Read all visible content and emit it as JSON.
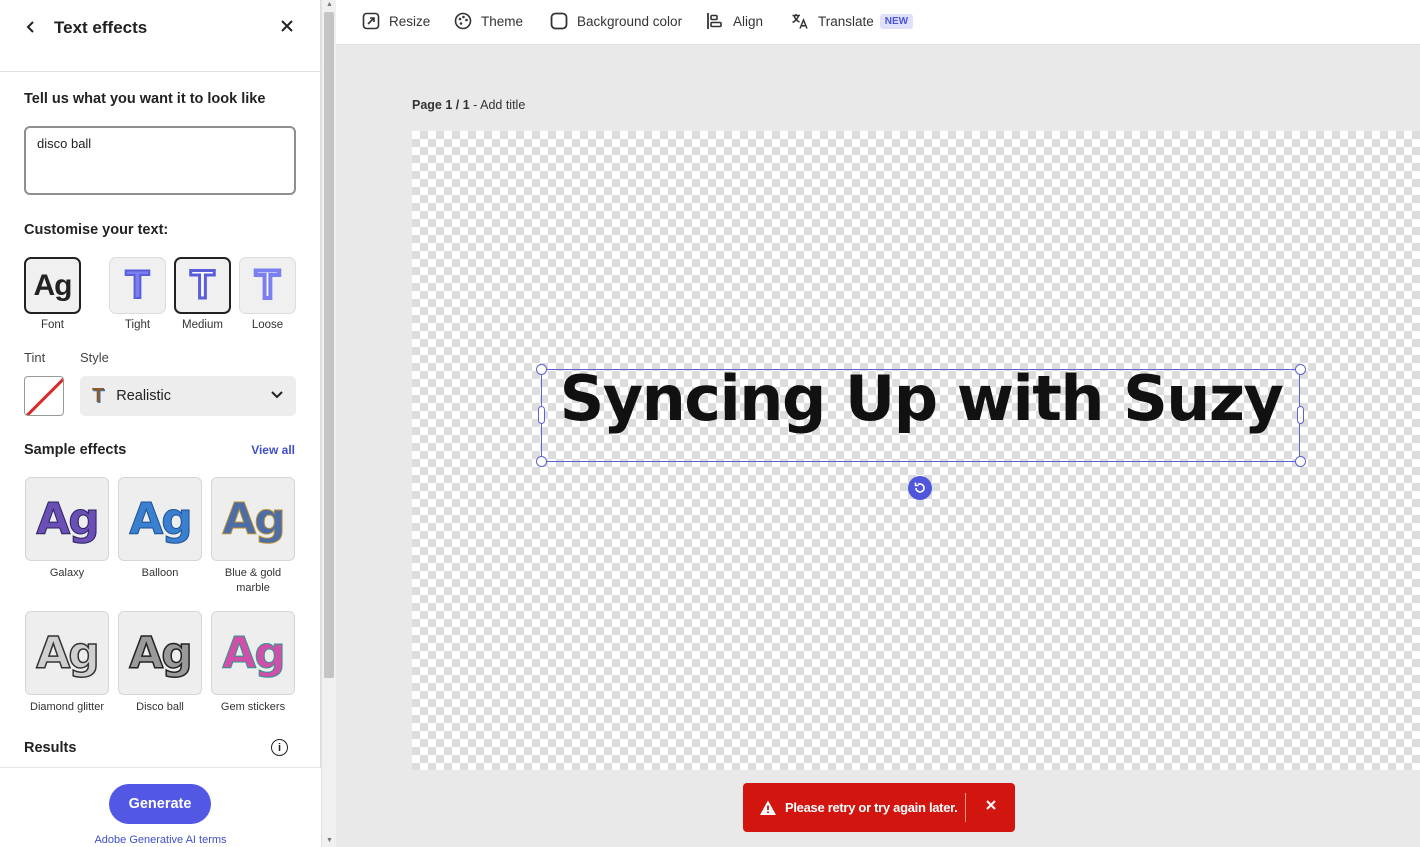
{
  "panel": {
    "title": "Text effects",
    "prompt_label": "Tell us what you want it to look like",
    "prompt_value": "disco ball",
    "customise_label": "Customise your text:",
    "custom_options": [
      {
        "label": "Font",
        "glyph": "Ag",
        "selected": true
      },
      {
        "label": "Tight",
        "glyph": "T",
        "selected": false
      },
      {
        "label": "Medium",
        "glyph": "T",
        "selected": true
      },
      {
        "label": "Loose",
        "glyph": "T",
        "selected": false
      }
    ],
    "tint_label": "Tint",
    "style_label": "Style",
    "style_value": "Realistic",
    "sample_label": "Sample effects",
    "view_all": "View all",
    "effects": [
      {
        "label": "Galaxy",
        "glyph": "Ag"
      },
      {
        "label": "Balloon",
        "glyph": "Ag"
      },
      {
        "label": "Blue & gold marble",
        "glyph": "Ag"
      },
      {
        "label": "Diamond glitter",
        "glyph": "Ag"
      },
      {
        "label": "Disco ball",
        "glyph": "Ag"
      },
      {
        "label": "Gem stickers",
        "glyph": "Ag"
      }
    ],
    "results_label": "Results",
    "generate_label": "Generate",
    "terms_label": "Adobe Generative AI terms"
  },
  "toolbar": {
    "resize": "Resize",
    "theme": "Theme",
    "background": "Background color",
    "align": "Align",
    "translate": "Translate",
    "translate_badge": "NEW"
  },
  "canvas": {
    "page_indicator": "Page 1 / 1",
    "page_sep": " - ",
    "add_title": "Add title",
    "text": "Syncing Up with Suzy"
  },
  "toast": {
    "message": "Please retry or try again later."
  },
  "colors": {
    "accent": "#5258e4",
    "error": "#d31510",
    "link": "#3f4fc9"
  }
}
